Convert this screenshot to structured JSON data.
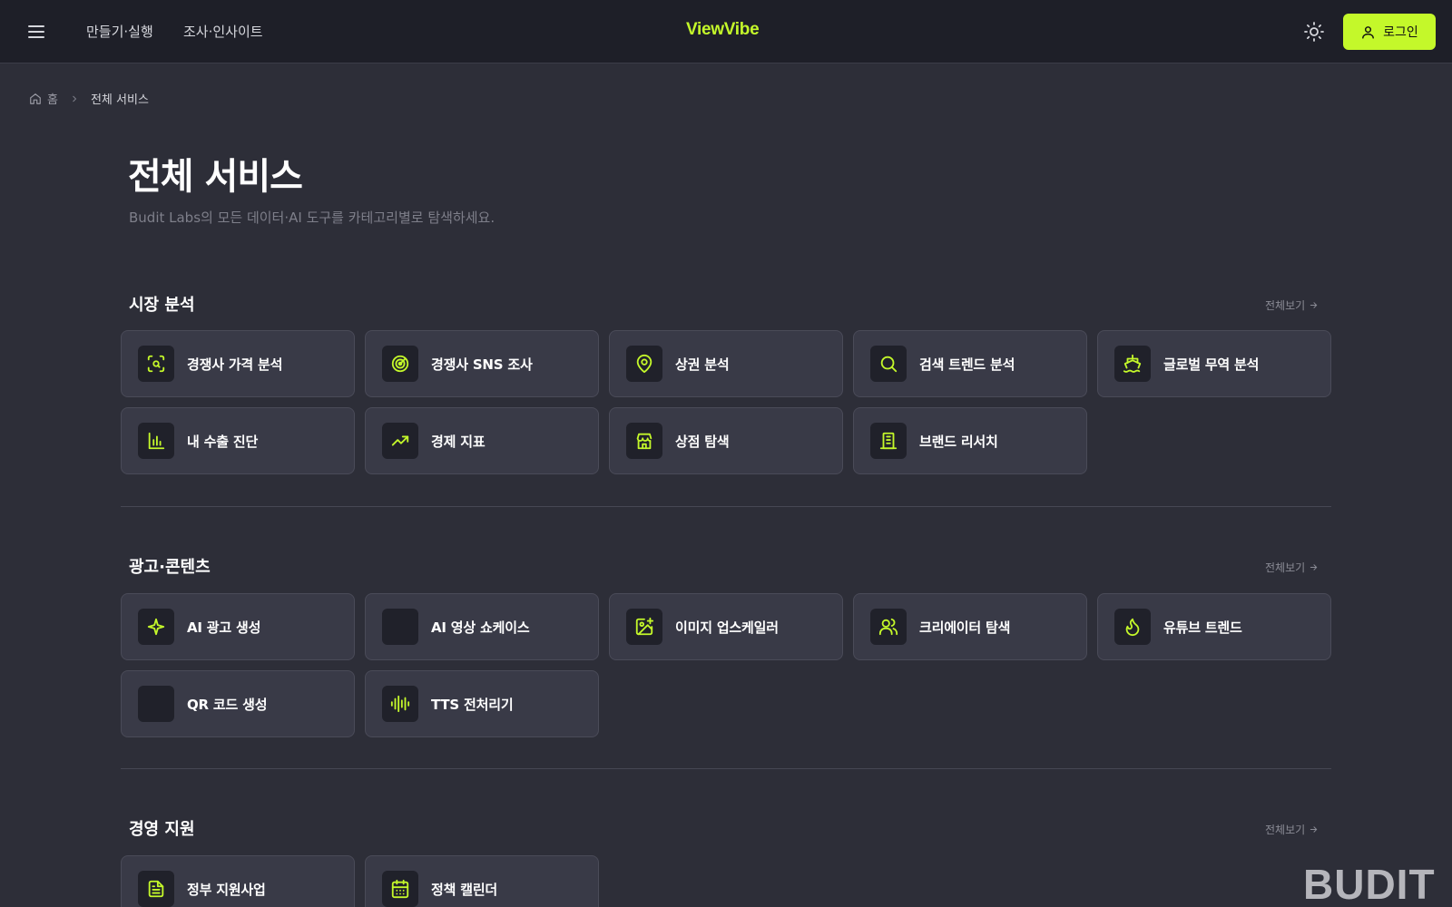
{
  "header": {
    "nav": [
      "만들기·실행",
      "조사·인사이트"
    ],
    "logo": "ViewVibe",
    "login_label": "로그인"
  },
  "breadcrumb": {
    "home": "홈",
    "current": "전체 서비스"
  },
  "page": {
    "title": "전체 서비스",
    "subtitle": "Budit Labs의 모든 데이터·AI 도구를 카테고리별로 탐색하세요."
  },
  "sections": [
    {
      "title": "시장 분석",
      "see_all": "전체보기",
      "items": [
        {
          "label": "경쟁사 가격 분석",
          "icon": "scan-search-icon"
        },
        {
          "label": "경쟁사 SNS 조사",
          "icon": "radar-icon"
        },
        {
          "label": "상권 분석",
          "icon": "map-pin-icon"
        },
        {
          "label": "검색 트렌드 분석",
          "icon": "search-icon"
        },
        {
          "label": "글로벌 무역 분석",
          "icon": "ship-icon"
        },
        {
          "label": "내 수출 진단",
          "icon": "bar-chart-icon"
        },
        {
          "label": "경제 지표",
          "icon": "trending-up-icon"
        },
        {
          "label": "상점 탐색",
          "icon": "store-icon"
        },
        {
          "label": "브랜드 리서치",
          "icon": "building-icon"
        }
      ]
    },
    {
      "title": "광고·콘텐츠",
      "see_all": "전체보기",
      "items": [
        {
          "label": "AI 광고 생성",
          "icon": "sparkle-icon"
        },
        {
          "label": "AI 영상 쇼케이스",
          "icon": "blank-icon"
        },
        {
          "label": "이미지 업스케일러",
          "icon": "image-plus-icon"
        },
        {
          "label": "크리에이터 탐색",
          "icon": "users-icon"
        },
        {
          "label": "유튜브 트렌드",
          "icon": "flame-icon"
        },
        {
          "label": "QR 코드 생성",
          "icon": "blank-icon"
        },
        {
          "label": "TTS 전처리기",
          "icon": "audio-wave-icon"
        }
      ]
    },
    {
      "title": "경영 지원",
      "see_all": "전체보기",
      "items": [
        {
          "label": "정부 지원사업",
          "icon": "file-text-icon"
        },
        {
          "label": "정책 캘린더",
          "icon": "calendar-icon"
        }
      ]
    }
  ],
  "watermark": "BUDIT",
  "colors": {
    "accent": "#c4f82a",
    "background": "#2d2e38",
    "header": "#1e1f28",
    "card": "#393a47"
  }
}
